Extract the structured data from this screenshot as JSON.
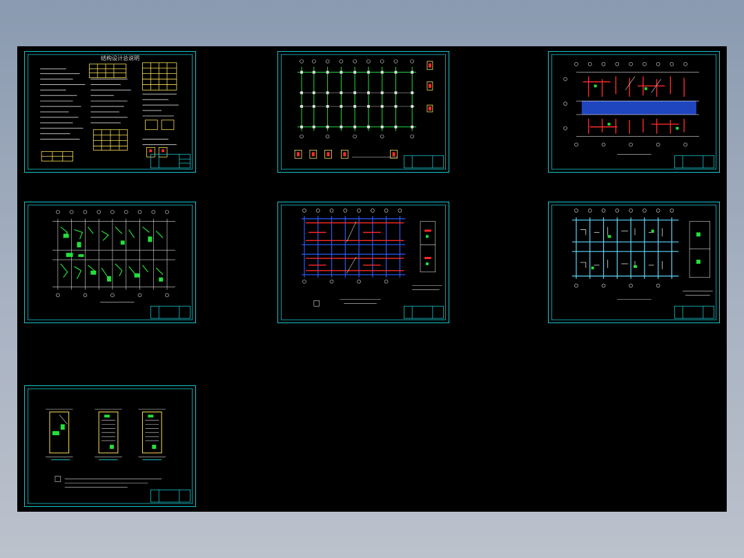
{
  "viewer": {
    "background": "#000000",
    "frame_color": "#18c8d0",
    "sheets": [
      {
        "id": "notes",
        "title": "结构设计总说明"
      },
      {
        "id": "foundation-plan",
        "title": ""
      },
      {
        "id": "floor1-reinforcement",
        "title": ""
      },
      {
        "id": "floor2-reinforcement",
        "title": ""
      },
      {
        "id": "roof-beam-plan",
        "title": ""
      },
      {
        "id": "roof-slab-plan",
        "title": ""
      },
      {
        "id": "stair-details",
        "title": ""
      }
    ]
  },
  "colors": {
    "cyan": "#18c8d0",
    "yellow": "#ffe45a",
    "green": "#22e03a",
    "red": "#ff2a2a",
    "blue": "#2a5cff",
    "white": "#e0e0e0"
  }
}
